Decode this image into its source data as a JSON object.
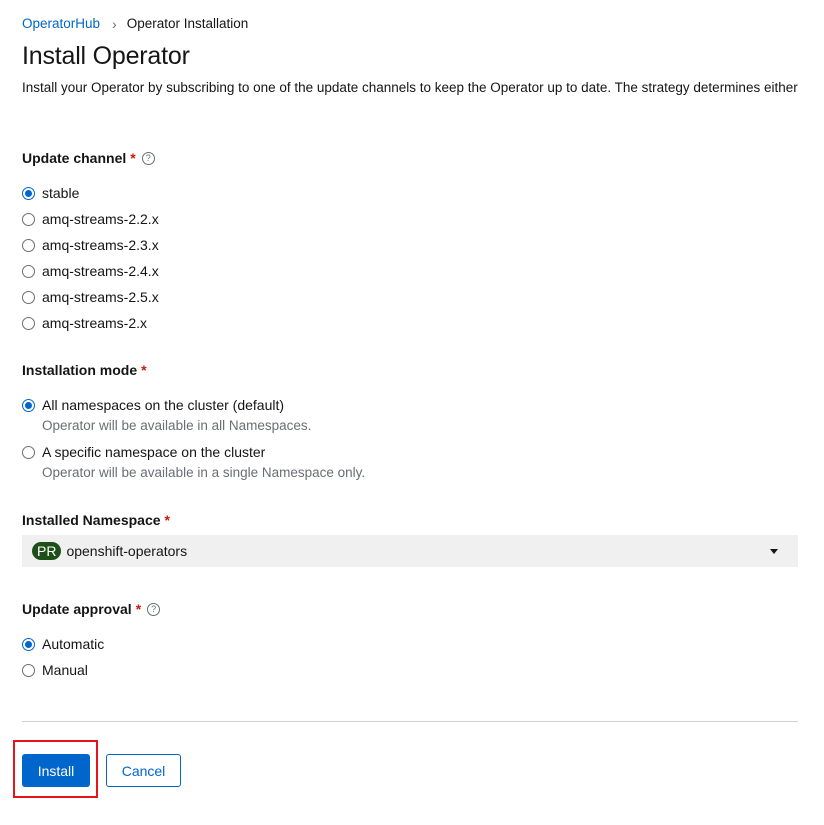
{
  "breadcrumb": {
    "parent": "OperatorHub",
    "separator": "›",
    "current": "Operator Installation"
  },
  "page": {
    "title": "Install Operator",
    "description": "Install your Operator by subscribing to one of the update channels to keep the Operator up to date. The strategy determines either"
  },
  "update_channel": {
    "label": "Update channel",
    "required_mark": "*",
    "help_icon": "?",
    "selected": "stable",
    "options": [
      {
        "label": "stable",
        "checked": true
      },
      {
        "label": "amq-streams-2.2.x",
        "checked": false
      },
      {
        "label": "amq-streams-2.3.x",
        "checked": false
      },
      {
        "label": "amq-streams-2.4.x",
        "checked": false
      },
      {
        "label": "amq-streams-2.5.x",
        "checked": false
      },
      {
        "label": "amq-streams-2.x",
        "checked": false
      }
    ]
  },
  "installation_mode": {
    "label": "Installation mode",
    "required_mark": "*",
    "options": [
      {
        "label": "All namespaces on the cluster (default)",
        "description": "Operator will be available in all Namespaces.",
        "checked": true
      },
      {
        "label": "A specific namespace on the cluster",
        "description": "Operator will be available in a single Namespace only.",
        "checked": false
      }
    ]
  },
  "installed_namespace": {
    "label": "Installed Namespace",
    "required_mark": "*",
    "badge": "PR",
    "value": "openshift-operators"
  },
  "update_approval": {
    "label": "Update approval",
    "required_mark": "*",
    "help_icon": "?",
    "options": [
      {
        "label": "Automatic",
        "checked": true
      },
      {
        "label": "Manual",
        "checked": false
      }
    ]
  },
  "actions": {
    "install_label": "Install",
    "cancel_label": "Cancel"
  },
  "colors": {
    "link": "#0066cc",
    "primary_button": "#0066cc",
    "required": "#c9190b",
    "badge_bg": "#1e4f18",
    "highlight": "#e8141b"
  }
}
